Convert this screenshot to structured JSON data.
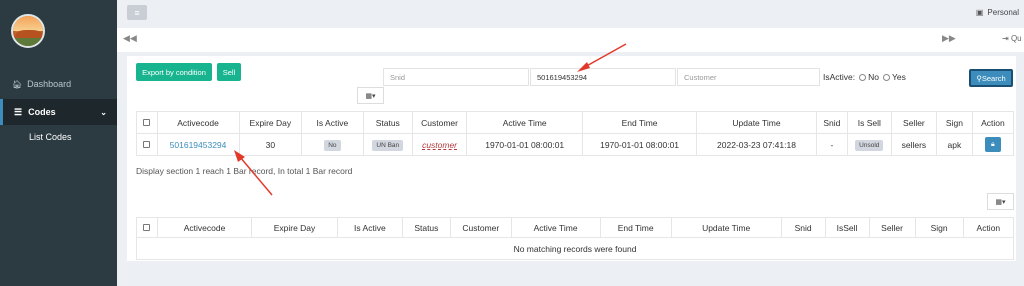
{
  "sidebar": {
    "items": [
      {
        "label": "Dashboard",
        "icon": "home-icon"
      },
      {
        "label": "Codes",
        "icon": "list-icon"
      }
    ],
    "submenu": [
      {
        "label": "List Codes"
      }
    ]
  },
  "topbar": {
    "menu_icon": "≡",
    "personal_label": "Personal"
  },
  "tabs": {
    "quit_label": "Qu"
  },
  "toolbar": {
    "export_label": "Export by condition",
    "sell_label": "Sell",
    "cols_icon": "▦▾"
  },
  "search": {
    "snid_placeholder": "Snid",
    "code_value": "501619453294",
    "customer_placeholder": "Customer",
    "isactive_label": "IsActive:",
    "no_label": "No",
    "yes_label": "Yes",
    "search_label": "Search"
  },
  "table1": {
    "headers": [
      "Activecode",
      "Expire Day",
      "Is Active",
      "Status",
      "Customer",
      "Active Time",
      "End Time",
      "Update Time",
      "Snid",
      "Is Sell",
      "Seller",
      "Sign",
      "Action"
    ],
    "row": {
      "activecode": "501619453294",
      "expire_day": "30",
      "is_active": "No",
      "status": "UN Ban",
      "customer": "customer",
      "active_time": "1970-01-01 08:00:01",
      "end_time": "1970-01-01 08:00:01",
      "update_time": "2022-03-23 07:41:18",
      "snid": "-",
      "is_sell": "Unsold",
      "seller": "sellers",
      "sign": "apk"
    }
  },
  "pager_text": "Display section 1 reach 1 Bar record, In total 1 Bar record",
  "table2": {
    "headers": [
      "Activecode",
      "Expire Day",
      "Is Active",
      "Status",
      "Customer",
      "Active Time",
      "End Time",
      "Update Time",
      "Snid",
      "IsSell",
      "Seller",
      "Sign",
      "Action"
    ],
    "empty_text": "No matching records were found"
  },
  "colors": {
    "sidebar_bg": "#2c3b41",
    "accent": "#3c8dbc",
    "green_button": "#18b490",
    "annotation_arrow": "#e23a2a"
  }
}
